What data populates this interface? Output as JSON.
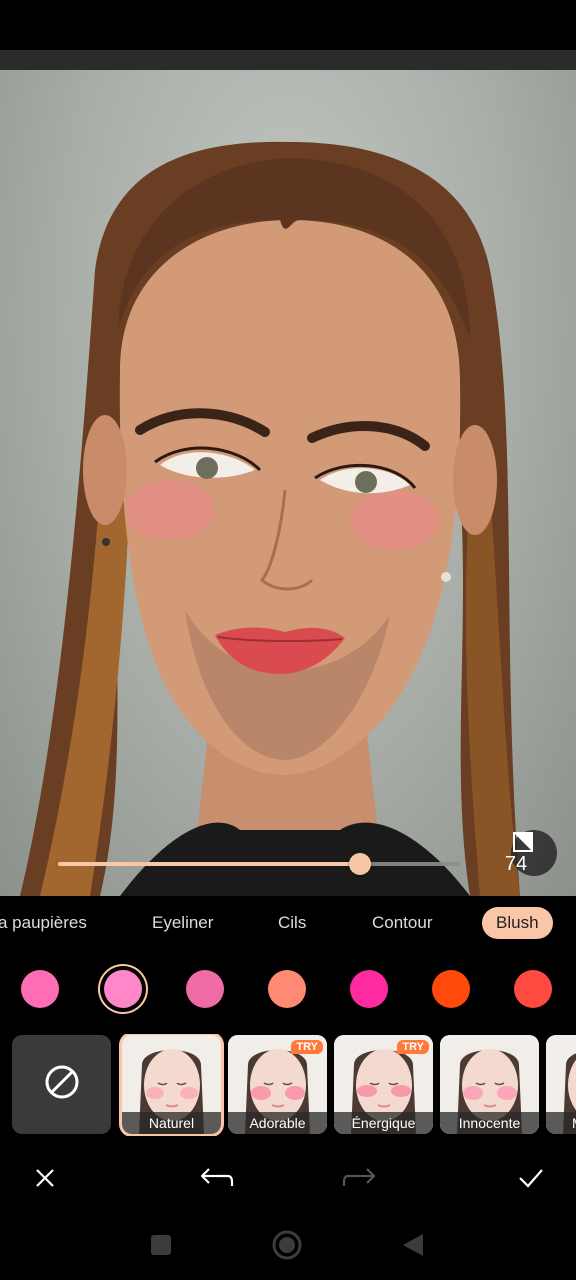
{
  "editor": {
    "intensity_value": "74",
    "intensity_fraction": 0.75
  },
  "tabs": [
    {
      "label": "a paupières"
    },
    {
      "label": "Eyeliner"
    },
    {
      "label": "Cils"
    },
    {
      "label": "Contour"
    },
    {
      "label": "Blush",
      "active": true
    }
  ],
  "swatches": [
    {
      "color": "#ff6eb4"
    },
    {
      "color": "#ff86c8",
      "selected": true
    },
    {
      "color": "#ee6ba5"
    },
    {
      "color": "#ff8a73"
    },
    {
      "color": "#ff2aa0"
    },
    {
      "color": "#ff4a0c"
    },
    {
      "color": "#ff4a42"
    }
  ],
  "presets": [
    {
      "label": "Naturel",
      "selected": true
    },
    {
      "label": "Adorable",
      "badge": "TRY"
    },
    {
      "label": "Énergique",
      "badge": "TRY"
    },
    {
      "label": "Innocente"
    },
    {
      "label": "M"
    }
  ],
  "colors": {
    "accent": "#f9c7a7",
    "badge": "#ff7a3a"
  },
  "icons": {
    "compare": "split-compare-icon",
    "none": "no-effect-icon",
    "cancel": "close-icon",
    "undo": "undo-icon",
    "redo": "redo-icon",
    "confirm": "check-icon"
  }
}
